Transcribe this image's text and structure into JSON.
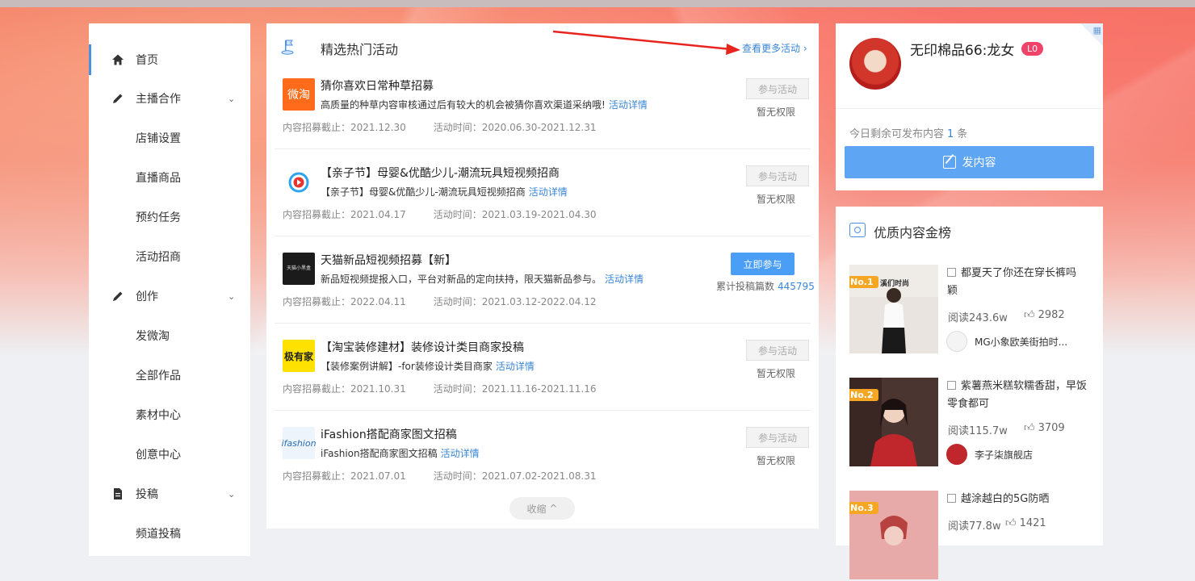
{
  "colors": {
    "accent": "#4a9ef5",
    "link": "#3a86d6",
    "badge": "#f5a623",
    "level": "#f0436a",
    "annotation_arrow": "#e8241f"
  },
  "sidebar": {
    "items": [
      {
        "label": "首页",
        "icon": "home-icon",
        "active": true
      },
      {
        "label": "主播合作",
        "icon": "pencil-icon",
        "expandable": true
      },
      {
        "label": "店铺设置"
      },
      {
        "label": "直播商品"
      },
      {
        "label": "预约任务"
      },
      {
        "label": "活动招商"
      },
      {
        "label": "创作",
        "icon": "pencil-icon",
        "expandable": true
      },
      {
        "label": "发微淘"
      },
      {
        "label": "全部作品"
      },
      {
        "label": "素材中心"
      },
      {
        "label": "创意中心"
      },
      {
        "label": "投稿",
        "icon": "document-icon",
        "expandable": true
      },
      {
        "label": "频道投稿"
      }
    ]
  },
  "main": {
    "title": "精选热门活动",
    "more_link": "查看更多活动",
    "collapse_label": "收缩",
    "activities": [
      {
        "logo_text": "微淘",
        "title": "猜你喜欢日常种草招募",
        "desc": "高质量的种草内容审核通过后有较大的机会被猜你喜欢渠道采纳哦!",
        "detail_link": "活动详情",
        "deadline": "内容招募截止：2021.12.30",
        "period": "活动时间：2020.06.30-2021.12.31",
        "button": "参与活动",
        "status": "暂无权限"
      },
      {
        "logo_text": "",
        "title": "【亲子节】母婴&优酷少儿-潮流玩具短视频招商",
        "desc": "【亲子节】母婴&优酷少儿-潮流玩具短视频招商",
        "detail_link": "活动详情",
        "deadline": "内容招募截止：2021.04.17",
        "period": "活动时间：2021.03.19-2021.04.30",
        "button": "参与活动",
        "status": "暂无权限"
      },
      {
        "logo_text": "天猫小黑盒",
        "title": "天猫新品短视频招募【新】",
        "desc": "新品短视频提报入口，平台对新品的定向扶持，限天猫新品参与。",
        "detail_link": "活动详情",
        "deadline": "内容招募截止：2022.04.11",
        "period": "活动时间：2021.03.12-2022.04.12",
        "button": "立即参与",
        "count_label": "累计投稿篇数",
        "count_value": "445795"
      },
      {
        "logo_text": "极有家",
        "title": "【淘宝装修建材】装修设计类目商家投稿",
        "desc": "【装修案例讲解】-for装修设计类目商家",
        "detail_link": "活动详情",
        "deadline": "内容招募截止：2021.10.31",
        "period": "活动时间：2021.11.16-2021.11.16",
        "button": "参与活动",
        "status": "暂无权限"
      },
      {
        "logo_text": "ifashion",
        "title": "iFashion搭配商家图文招稿",
        "desc": "iFashion搭配商家图文招稿",
        "detail_link": "活动详情",
        "deadline": "内容招募截止：2021.07.01",
        "period": "活动时间：2021.07.02-2021.08.31",
        "button": "参与活动",
        "status": "暂无权限"
      }
    ]
  },
  "profile": {
    "username": "无印棉品66:龙女",
    "level": "L0",
    "remain_prefix": "今日剩余可发布内容",
    "remain_count": "1",
    "remain_suffix": "条",
    "publish_button": "发内容"
  },
  "ranking": {
    "title": "优质内容金榜",
    "items": [
      {
        "badge": "No.1",
        "thumb_text": "溪们时尚",
        "title": "都夏天了你还在穿长裤吗 颖",
        "reads": "阅读243.6w",
        "likes": "2982",
        "author": "MG小象欧美街拍时..."
      },
      {
        "badge": "No.2",
        "title": "紫薯燕米糕软糯香甜，早饭零食都可",
        "reads": "阅读115.7w",
        "likes": "3709",
        "author": "李子柒旗舰店"
      },
      {
        "badge": "No.3",
        "title": "越涂越白的5G防晒",
        "reads": "阅读77.8w",
        "likes": "1421"
      }
    ]
  }
}
